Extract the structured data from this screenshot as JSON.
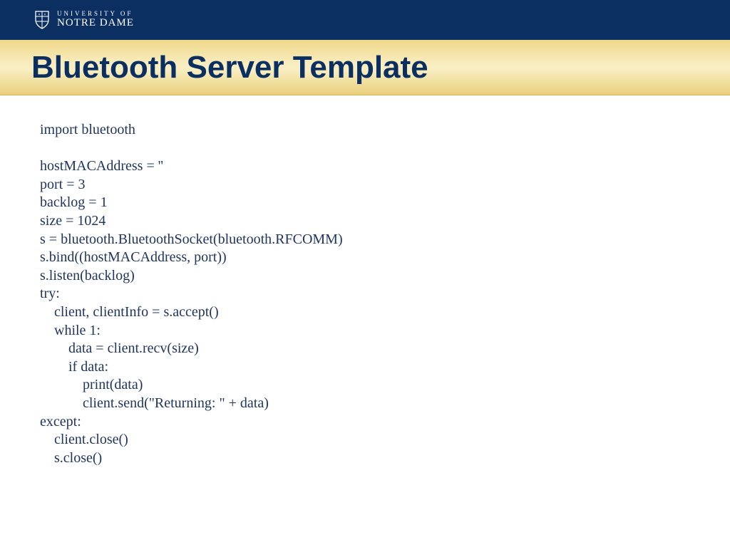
{
  "header": {
    "logo_top": "UNIVERSITY OF",
    "logo_bottom": "NOTRE DAME"
  },
  "title": "Bluetooth Server Template",
  "code": {
    "line1": "import bluetooth",
    "blank1": "",
    "line2": "hostMACAddress = ''",
    "line3": "port = 3",
    "line4": "backlog = 1",
    "line5": "size = 1024",
    "line6": "s = bluetooth.BluetoothSocket(bluetooth.RFCOMM)",
    "line7": "s.bind((hostMACAddress, port))",
    "line8": "s.listen(backlog)",
    "line9": "try:",
    "line10": "    client, clientInfo = s.accept()",
    "line11": "    while 1:",
    "line12": "        data = client.recv(size)",
    "line13": "        if data:",
    "line14": "            print(data)",
    "line15": "            client.send(\"Returning: \" + data)",
    "line16": "except:",
    "line17": "    client.close()",
    "line18": "    s.close()"
  }
}
